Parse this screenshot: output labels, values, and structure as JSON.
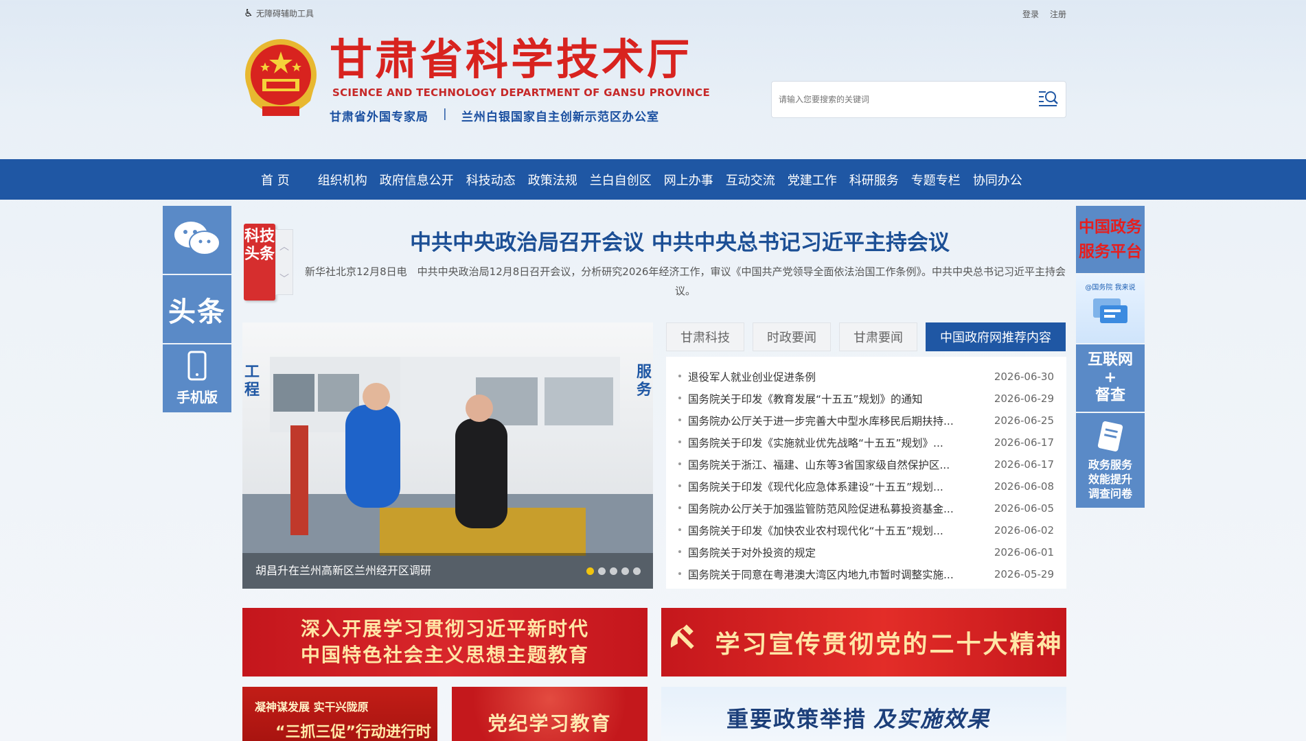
{
  "topbar": {
    "access_label": "无障碍辅助工具",
    "login": "登录",
    "register": "注册"
  },
  "header": {
    "title_cn": "甘肃省科学技术厅",
    "title_en": "SCIENCE AND TECHNOLOGY DEPARTMENT OF GANSU PROVINCE",
    "sub_left": "甘肃省外国专家局",
    "sub_sep": "|",
    "sub_right": "兰州白银国家自主创新示范区办公室"
  },
  "search": {
    "placeholder": "请输入您要搜索的关键词"
  },
  "nav": {
    "items": [
      "首 页",
      "组织机构",
      "政府信息公开",
      "科技动态",
      "政策法规",
      "兰白自创区",
      "网上办事",
      "互动交流",
      "党建工作",
      "科研服务",
      "专题专栏",
      "协同办公"
    ]
  },
  "left_float": {
    "toutiao": "头条",
    "mobile": "手机版"
  },
  "right_float": {
    "gov_service_line1": "中国政务",
    "gov_service_line2": "服务平台",
    "gwy_small": "@国务院 我来说",
    "internet_line1": "互联网",
    "internet_line2": "+",
    "internet_line3": "督查",
    "survey_line1": "政务服务",
    "survey_line2": "效能提升",
    "survey_line3": "调查问卷"
  },
  "headline": {
    "badge": "科技头条",
    "title": "中共中央政治局召开会议 中共中央总书记习近平主持会议",
    "desc": "新华社北京12月8日电　中共中央政治局12月8日召开会议，分析研究2026年经济工作，审议《中国共产党领导全面依法治国工作条例》。中共中央总书记习近平主持会议。"
  },
  "slider": {
    "caption": "胡昌升在兰州高新区兰州经开区调研",
    "left_label": "工程",
    "right_label": "服务",
    "dots": 5,
    "active_dot": 0
  },
  "tabs": [
    "甘肃科技",
    "时政要闻",
    "甘肃要闻",
    "中国政府网推荐内容"
  ],
  "active_tab": 3,
  "news": [
    {
      "title": "退役军人就业创业促进条例",
      "date": "2026-06-30"
    },
    {
      "title": "国务院关于印发《教育发展“十五五”规划》的通知",
      "date": "2026-06-29"
    },
    {
      "title": "国务院办公厅关于进一步完善大中型水库移民后期扶持...",
      "date": "2026-06-25"
    },
    {
      "title": "国务院关于印发《实施就业优先战略“十五五”规划》...",
      "date": "2026-06-17"
    },
    {
      "title": "国务院关于浙江、福建、山东等3省国家级自然保护区...",
      "date": "2026-06-17"
    },
    {
      "title": "国务院关于印发《现代化应急体系建设“十五五”规划...",
      "date": "2026-06-08"
    },
    {
      "title": "国务院办公厅关于加强监管防范风险促进私募投资基金...",
      "date": "2026-06-05"
    },
    {
      "title": "国务院关于印发《加快农业农村现代化“十五五”规划...",
      "date": "2026-06-02"
    },
    {
      "title": "国务院关于对外投资的规定",
      "date": "2026-06-01"
    },
    {
      "title": "国务院关于同意在粤港澳大湾区内地九市暂时调整实施...",
      "date": "2026-05-29"
    }
  ],
  "banners": {
    "b1_line1": "深入开展学习贯彻习近平新时代",
    "b1_line2": "中国特色社会主义思想主题教育",
    "b2": "学习宣传贯彻党的二十大精神",
    "b3_line1": "凝神谋发展 实干兴陇原",
    "b3_line2": "“三抓三促”行动进行时",
    "b4": "党纪学习教育",
    "b5_part1": "重要政策举措",
    "b5_part2": "及实施效果"
  },
  "colors": {
    "nav_blue": "#1f57a4",
    "title_red": "#d8231f",
    "float_blue": "#5a8ac7",
    "headline_blue": "#1c4f95"
  }
}
